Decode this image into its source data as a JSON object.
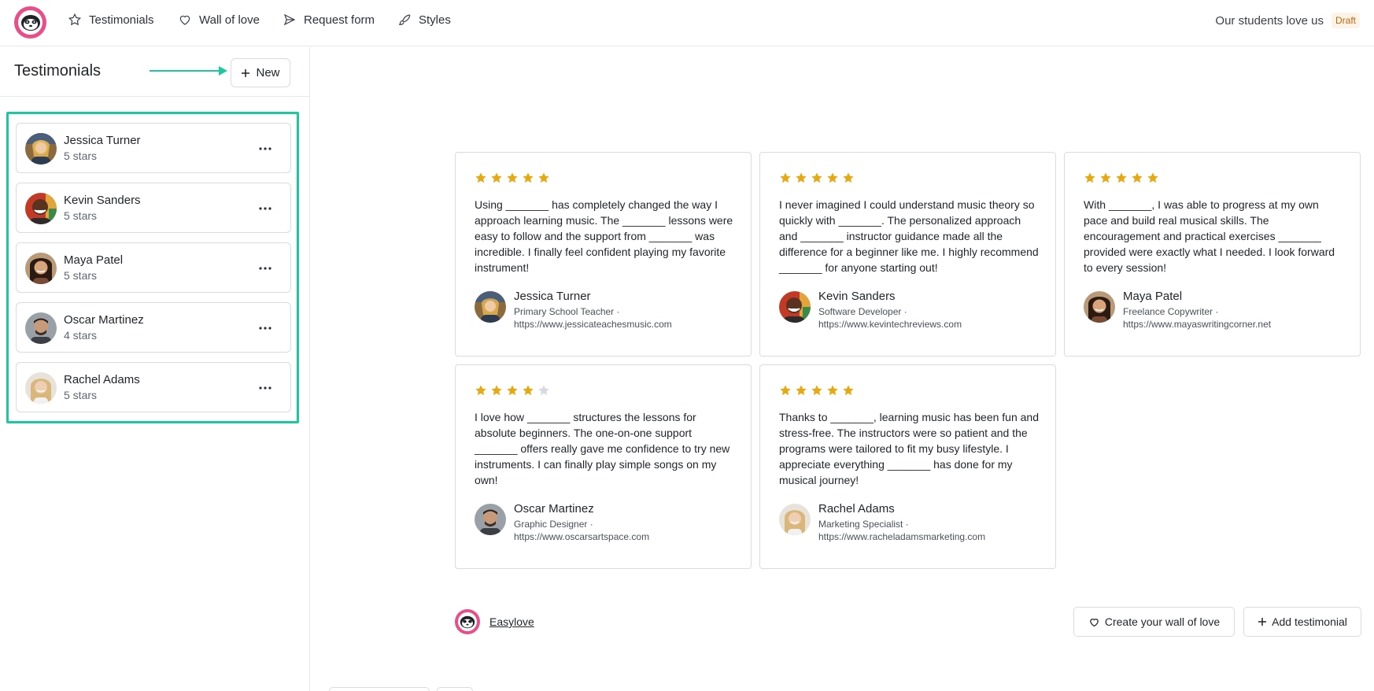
{
  "nav": {
    "items": [
      {
        "label": "Testimonials",
        "icon": "star-icon"
      },
      {
        "label": "Wall of love",
        "icon": "heart-icon"
      },
      {
        "label": "Request form",
        "icon": "send-icon"
      },
      {
        "label": "Styles",
        "icon": "brush-icon"
      }
    ],
    "project_name": "Our students love us",
    "status_badge": "Draft"
  },
  "sidebar": {
    "title": "Testimonials",
    "new_button": "New",
    "items": [
      {
        "name": "Jessica Turner",
        "rating_text": "5 stars"
      },
      {
        "name": "Kevin Sanders",
        "rating_text": "5 stars"
      },
      {
        "name": "Maya Patel",
        "rating_text": "5 stars"
      },
      {
        "name": "Oscar Martinez",
        "rating_text": "4 stars"
      },
      {
        "name": "Rachel Adams",
        "rating_text": "5 stars"
      }
    ]
  },
  "wall": {
    "cards": [
      {
        "rating": 5,
        "quote": "Using _______ has completely changed the way I approach learning music. The _______ lessons were easy to follow and the support from _______ was incredible. I finally feel confident playing my favorite instrument!",
        "name": "Jessica Turner",
        "role": "Primary School Teacher ·",
        "url": "https://www.jessicateachesmusic.com"
      },
      {
        "rating": 5,
        "quote": "I never imagined I could understand music theory so quickly with _______. The personalized approach and _______ instructor guidance made all the difference for a beginner like me. I highly recommend _______ for anyone starting out!",
        "name": "Kevin Sanders",
        "role": "Software Developer ·",
        "url": "https://www.kevintechreviews.com"
      },
      {
        "rating": 5,
        "quote": "With _______, I was able to progress at my own pace and build real musical skills. The encouragement and practical exercises _______ provided were exactly what I needed. I look forward to every session!",
        "name": "Maya Patel",
        "role": "Freelance Copywriter ·",
        "url": "https://www.mayaswritingcorner.net"
      },
      {
        "rating": 4,
        "quote": "I love how _______ structures the lessons for absolute beginners. The one-on-one support _______ offers really gave me confidence to try new instruments. I can finally play simple songs on my own!",
        "name": "Oscar Martinez",
        "role": "Graphic Designer ·",
        "url": "https://www.oscarsartspace.com"
      },
      {
        "rating": 5,
        "quote": "Thanks to _______, learning music has been fun and stress-free. The instructors were so patient and the programs were tailored to fit my busy lifestyle. I appreciate everything _______ has done for my musical journey!",
        "name": "Rachel Adams",
        "role": "Marketing Specialist ·",
        "url": "https://www.racheladamsmarketing.com"
      }
    ]
  },
  "footer": {
    "brand": "Easylove",
    "wall_button": "Create your wall of love",
    "add_button": "Add testimonial"
  },
  "colors": {
    "accent": "#1fc7a0",
    "brand": "#e84f8a",
    "star": "#e7a912",
    "star_empty": "#d6d9de"
  }
}
